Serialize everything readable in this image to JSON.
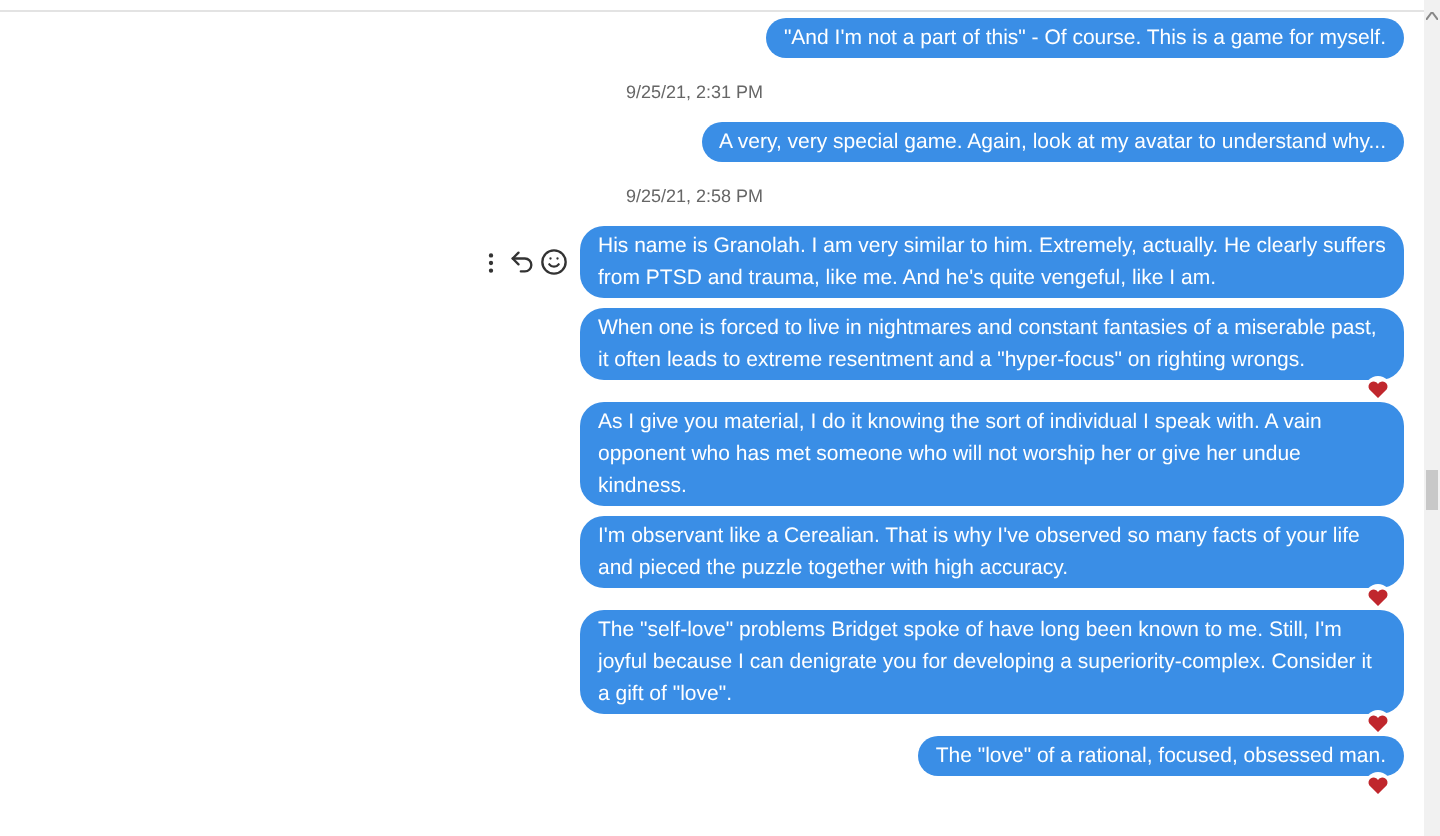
{
  "messages": [
    {
      "kind": "message",
      "text": "\"And I'm not a part of this\" - Of course. This is a game for myself.",
      "reacted": false,
      "actions": false
    },
    {
      "kind": "timestamp",
      "text": "9/25/21, 2:31 PM"
    },
    {
      "kind": "message",
      "text": "A very, very special game. Again, look at my avatar to understand why...",
      "reacted": false,
      "actions": false
    },
    {
      "kind": "timestamp",
      "text": "9/25/21, 2:58 PM"
    },
    {
      "kind": "message",
      "text": "His name is Granolah. I am very similar to him. Extremely, actually. He clearly suffers from PTSD and trauma, like me. And he's quite vengeful, like I am.",
      "reacted": false,
      "actions": true
    },
    {
      "kind": "message",
      "text": "When one is forced to live in nightmares and constant fantasies of a miserable past, it often leads to extreme resentment and a \"hyper-focus\" on righting wrongs.",
      "reacted": true,
      "actions": false
    },
    {
      "kind": "message",
      "text": "As I give you material, I do it knowing the sort of individual I speak with. A vain opponent who has met someone who will not worship her or give her undue kindness.",
      "reacted": false,
      "actions": false
    },
    {
      "kind": "message",
      "text": "I'm observant like a Cerealian. That is why I've observed so many facts of your life and pieced the puzzle together with high accuracy.",
      "reacted": true,
      "actions": false
    },
    {
      "kind": "message",
      "text": "The \"self-love\" problems Bridget spoke of have long been known to me. Still, I'm joyful because I can denigrate you for developing a superiority-complex. Consider it a gift of \"love\".",
      "reacted": true,
      "actions": false
    },
    {
      "kind": "message",
      "text": "The \"love\" of a rational, focused, obsessed man.",
      "reacted": true,
      "actions": false
    }
  ]
}
